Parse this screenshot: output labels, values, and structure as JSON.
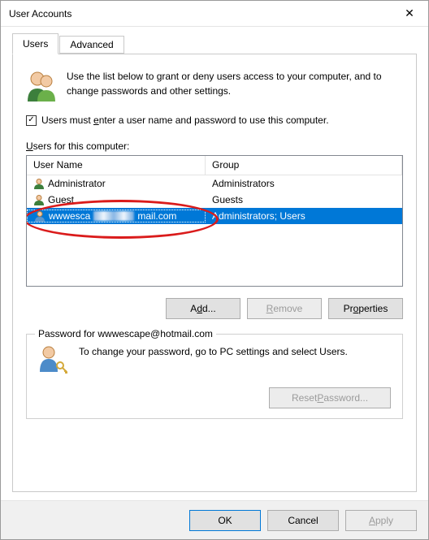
{
  "window": {
    "title": "User Accounts",
    "close_glyph": "✕"
  },
  "tabs": {
    "users": "Users",
    "advanced": "Advanced"
  },
  "intro_text": "Use the list below to grant or deny users access to your computer, and to change passwords and other settings.",
  "checkbox": {
    "checked_glyph": "✓",
    "label_pre": "Users must ",
    "label_accel": "e",
    "label_post": "nter a user name and password to use this computer."
  },
  "list_label_pre": "",
  "list_label_accel": "U",
  "list_label_post": "sers for this computer:",
  "columns": {
    "name": "User Name",
    "group": "Group"
  },
  "rows": [
    {
      "name": "Administrator",
      "group": "Administrators"
    },
    {
      "name": "Guest",
      "group": "Guests"
    },
    {
      "name_prefix": "wwwesca",
      "name_suffix": "mail.com",
      "group": "Administrators; Users",
      "selected": true,
      "censored": true
    }
  ],
  "buttons": {
    "add_pre": "A",
    "add_accel": "d",
    "add_post": "d...",
    "remove_pre": "",
    "remove_accel": "R",
    "remove_post": "emove",
    "properties_pre": "Pr",
    "properties_accel": "o",
    "properties_post": "perties"
  },
  "password_box": {
    "legend": "Password for wwwescape@hotmail.com",
    "text": "To change your password, go to PC settings and select Users.",
    "reset_pre": "Reset ",
    "reset_accel": "P",
    "reset_post": "assword..."
  },
  "footer": {
    "ok": "OK",
    "cancel": "Cancel",
    "apply_pre": "",
    "apply_accel": "A",
    "apply_post": "pply"
  },
  "annotation": {
    "type": "ellipse",
    "desc": "red ellipse highlighting selected user row"
  }
}
